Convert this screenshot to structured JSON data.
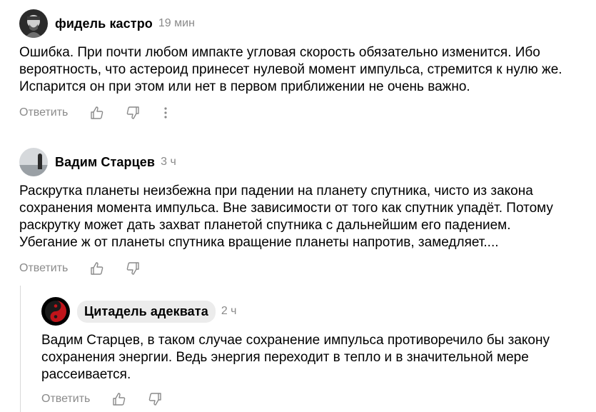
{
  "comments": [
    {
      "author": "фидель кастро",
      "time": "19 мин",
      "text": "Ошибка. При почти любом импакте угловая скорость обязательно изменится. Ибо\nвероятность, что астероид принесет нулевой момент импульса, стремится к нулю же.\nИспарится он при этом или нет в первом приближении не очень важно.",
      "reply_label": "Ответить",
      "like_icon": "thumbs-up-icon",
      "dislike_icon": "thumbs-down-icon",
      "more_icon": "more-vertical-icon"
    },
    {
      "author": "Вадим Старцев",
      "time": "3 ч",
      "text": "Раскрутка планеты неизбежна при падении на планету спутника, чисто из закона\nсохранения момента импульса. Вне зависимости от того как спутник упадёт. Потому\nраскрутку может дать захват планетой спутника с дальнейшим его падением.\nУбегание ж от планеты спутника вращение планеты напротив, замедляет....",
      "reply_label": "Ответить",
      "like_icon": "thumbs-up-icon",
      "dislike_icon": "thumbs-down-icon"
    },
    {
      "author": "Цитадель адеквата",
      "time": "2 ч",
      "text": "Вадим Старцев, в таком случае сохранение импульса противоречило бы закону\nсохранения энергии. Ведь энергия переходит в тепло и в значительной мере\nрассеивается.",
      "reply_label": "Ответить",
      "like_icon": "thumbs-up-icon",
      "dislike_icon": "thumbs-down-icon"
    }
  ],
  "colors": {
    "muted": "#8a8a8a",
    "pill_bg": "#ececec",
    "thread_line": "#d8d8d8"
  }
}
